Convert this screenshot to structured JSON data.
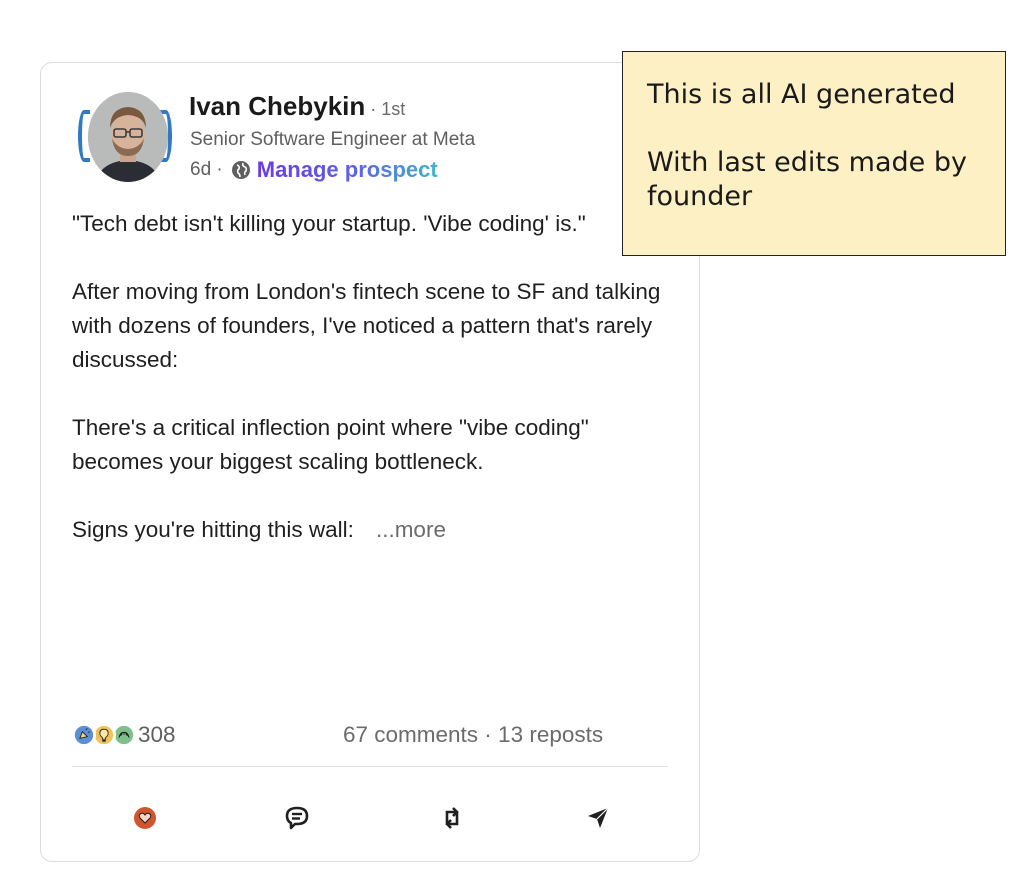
{
  "post": {
    "author": {
      "name": "Ivan Chebykin",
      "degree": " · 1st",
      "headline": "Senior Software Engineer at Meta",
      "age": "6d ·",
      "avatar": "avatar-photo"
    },
    "manage_label": "Manage prospect",
    "body": {
      "p1": "\"Tech debt isn't killing your startup. 'Vibe coding' is.\"",
      "p2": "After moving from London's fintech scene to SF and talking with dozens of founders, I've noticed a pattern that's rarely discussed:",
      "p3": "There's a critical inflection point where \"vibe coding\" becomes your biggest scaling bottleneck.",
      "p4": "Signs you're hitting this wall:",
      "more": "...more"
    },
    "social": {
      "reaction_icons": [
        "celebrate-icon",
        "insightful-icon",
        "support-icon"
      ],
      "reaction_count": "308",
      "stats": "67 comments · 13 reposts"
    },
    "actions": {
      "like_icon": "heart-icon",
      "comment_icon": "comment-icon",
      "repost_icon": "repost-icon",
      "send_icon": "send-icon"
    }
  },
  "note": {
    "line1": "This is all AI generated",
    "line2": "With last edits made by founder"
  },
  "colors": {
    "accent_purple": "#6a39e6",
    "accent_teal": "#3fb6c9",
    "note_bg": "#fdf0c4",
    "like_orange": "#d0552f"
  }
}
